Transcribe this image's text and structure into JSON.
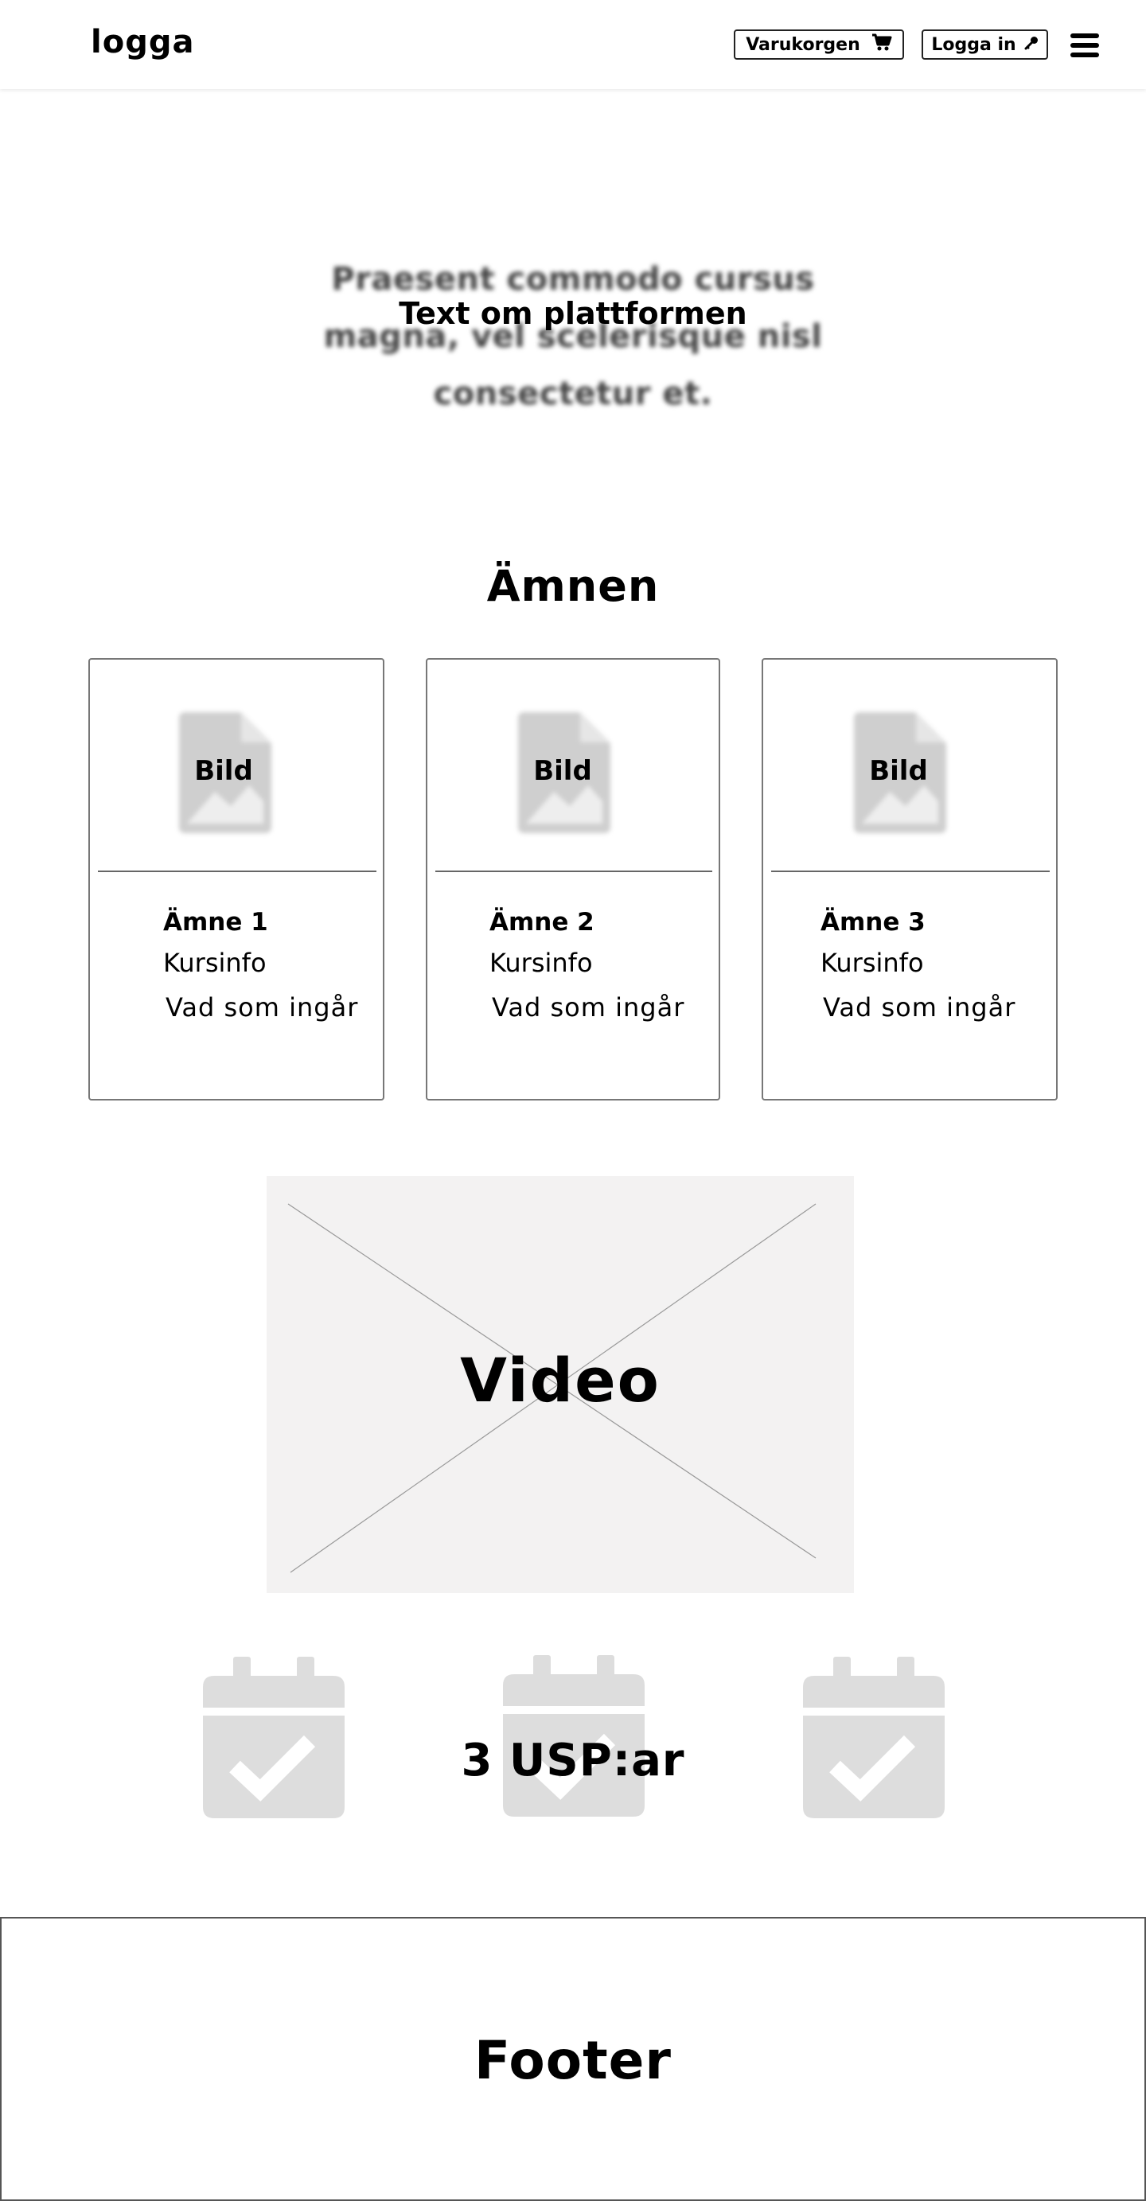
{
  "header": {
    "logo": "logga",
    "cart_label": "Varukorgen",
    "login_label": "Logga in",
    "cart_icon": "cart-icon",
    "login_icon": "key-icon",
    "menu_icon": "hamburger-menu-icon"
  },
  "hero": {
    "blurred_text": "Praesent commodo cursus magna, vel scelerisque nisl consectetur et.",
    "label": "Text om plattformen"
  },
  "subjects": {
    "title": "Ämnen",
    "cards": [
      {
        "image_label": "Bild",
        "title": "Ämne 1",
        "info": "Kursinfo",
        "includes": "Vad som ingår"
      },
      {
        "image_label": "Bild",
        "title": "Ämne 2",
        "info": "Kursinfo",
        "includes": "Vad som ingår"
      },
      {
        "image_label": "Bild",
        "title": "Ämne 3",
        "info": "Kursinfo",
        "includes": "Vad som ingår"
      }
    ]
  },
  "video": {
    "label": "Video"
  },
  "usps": {
    "label": "3 USP:ar",
    "icon": "calendar-check-icon"
  },
  "footer": {
    "label": "Footer"
  },
  "colors": {
    "placeholder_gray": "#dddddd",
    "video_bg": "#f3f2f2",
    "border": "#777777"
  }
}
